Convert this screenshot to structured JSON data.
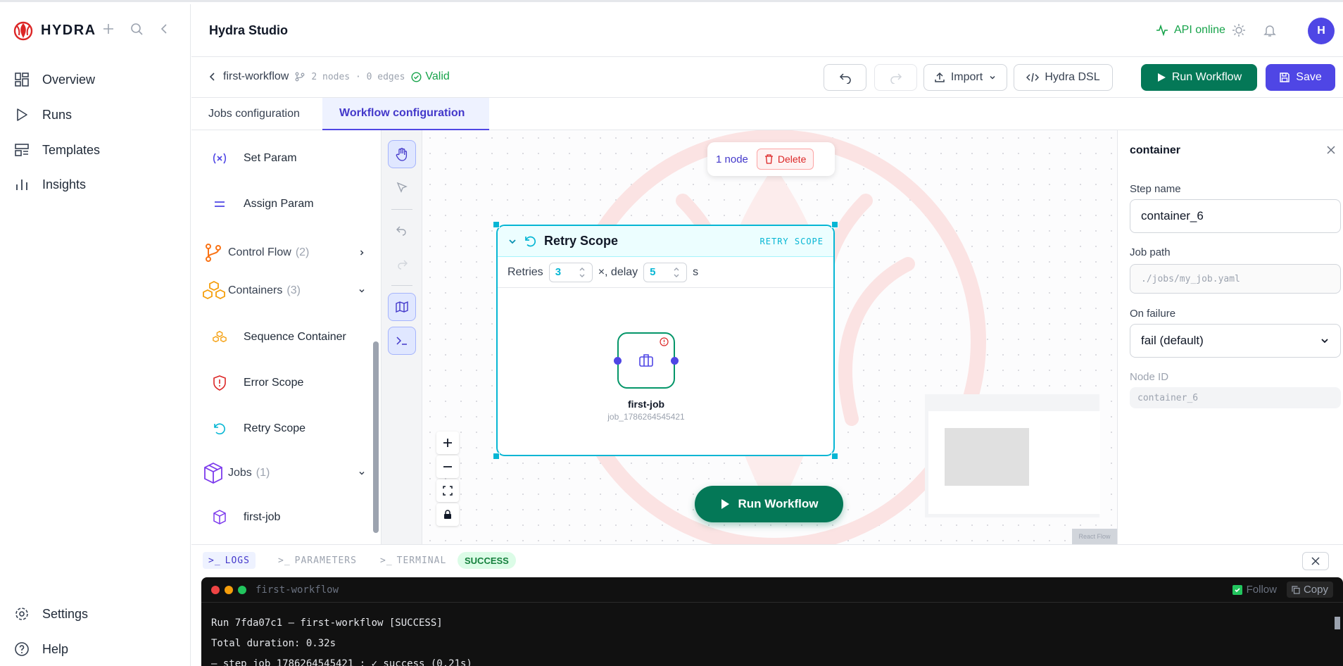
{
  "brand": {
    "name": "HYDRA"
  },
  "nav": {
    "items": [
      {
        "label": "Overview",
        "icon": "dashboard-icon"
      },
      {
        "label": "Runs",
        "icon": "play-icon"
      },
      {
        "label": "Templates",
        "icon": "templates-icon"
      },
      {
        "label": "Insights",
        "icon": "bar-chart-icon"
      }
    ],
    "bottom": [
      {
        "label": "Settings",
        "icon": "gear-icon"
      },
      {
        "label": "Help",
        "icon": "help-icon"
      }
    ]
  },
  "header": {
    "title": "Hydra Studio",
    "api_status": "API online",
    "avatar_initial": "H"
  },
  "toolbar": {
    "workflow_name": "first-workflow",
    "meta": "2 nodes · 0 edges",
    "valid_label": "Valid",
    "import_label": "Import",
    "dsl_label": "Hydra DSL",
    "run_label": "Run Workflow",
    "save_label": "Save"
  },
  "tabs": [
    {
      "label": "Jobs configuration",
      "active": false
    },
    {
      "label": "Workflow configuration",
      "active": true
    }
  ],
  "palette": {
    "items": [
      {
        "label": "Set Param"
      },
      {
        "label": "Assign Param"
      }
    ],
    "groups": {
      "control_flow": {
        "label": "Control Flow",
        "count": "(2)"
      },
      "containers": {
        "label": "Containers",
        "count": "(3)"
      },
      "jobs": {
        "label": "Jobs",
        "count": "(1)"
      }
    },
    "container_items": [
      {
        "label": "Sequence Container"
      },
      {
        "label": "Error Scope"
      },
      {
        "label": "Retry Scope"
      }
    ],
    "job_items": [
      {
        "label": "first-job"
      }
    ]
  },
  "canvas": {
    "selection": {
      "count_label": "1 node",
      "delete_label": "Delete"
    },
    "scope": {
      "title": "Retry Scope",
      "tag": "RETRY SCOPE",
      "retries_label": "Retries",
      "retries_value": "3",
      "delay_label": "×, delay",
      "delay_value": "5",
      "delay_unit": "s"
    },
    "job": {
      "name": "first-job",
      "id": "job_1786264545421"
    },
    "run_button": "Run Workflow",
    "attribution": "React Flow"
  },
  "properties": {
    "title": "container",
    "step_name_label": "Step name",
    "step_name_value": "container_6",
    "job_path_label": "Job path",
    "job_path_placeholder": "./jobs/my_job.yaml",
    "on_failure_label": "On failure",
    "on_failure_value": "fail (default)",
    "node_id_label": "Node ID",
    "node_id_value": "container_6"
  },
  "bottom": {
    "tabs": [
      {
        "label": "LOGS",
        "active": true
      },
      {
        "label": "PARAMETERS",
        "active": false
      },
      {
        "label": "TERMINAL",
        "active": false
      }
    ],
    "status_badge": "SUCCESS",
    "terminal": {
      "title": "first-workflow",
      "follow_label": "Follow",
      "copy_label": "Copy",
      "lines": [
        "Run 7fda07c1 — first-workflow [SUCCESS]",
        "Total duration: 0.32s",
        "— step job_1786264545421 : ✓ success (0.21s)"
      ]
    }
  },
  "colors": {
    "accent": "#4f46e5",
    "success": "#047857",
    "scope": "#06b6d4",
    "brand": "#dc2626"
  }
}
